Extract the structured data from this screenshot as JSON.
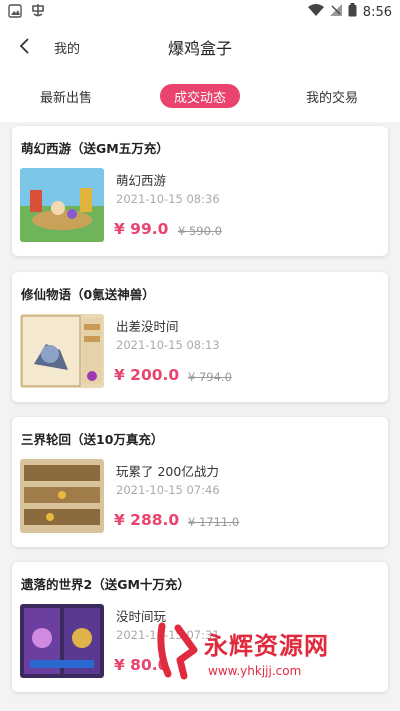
{
  "status_bar": {
    "time": "8:56"
  },
  "nav": {
    "back_label": "我的",
    "title": "爆鸡盒子"
  },
  "tabs": [
    {
      "label": "最新出售",
      "active": false
    },
    {
      "label": "成交动态",
      "active": true
    },
    {
      "label": "我的交易",
      "active": false
    }
  ],
  "items": [
    {
      "game": "萌幻西游（送GM五万充）",
      "name": "萌幻西游",
      "time": "2021-10-15 08:36",
      "price": "¥ 99.0",
      "original_price": "¥ 590.0"
    },
    {
      "game": "修仙物语（0氪送神兽）",
      "name": "出差没时间",
      "time": "2021-10-15 08:13",
      "price": "¥ 200.0",
      "original_price": "¥ 794.0"
    },
    {
      "game": "三界轮回（送10万真充）",
      "name": "玩累了  200亿战力",
      "time": "2021-10-15 07:46",
      "price": "¥ 288.0",
      "original_price": "¥ 1711.0"
    },
    {
      "game": "遗落的世界2（送GM十万充）",
      "name": "没时间玩",
      "time": "2021-10-15 07:31",
      "price": "¥ 80.0",
      "original_price": ""
    }
  ],
  "watermark": {
    "text": "永辉资源网",
    "url": "www.yhkjjj.com"
  },
  "colors": {
    "accent": "#e8446d",
    "watermark": "#e02b3e"
  }
}
